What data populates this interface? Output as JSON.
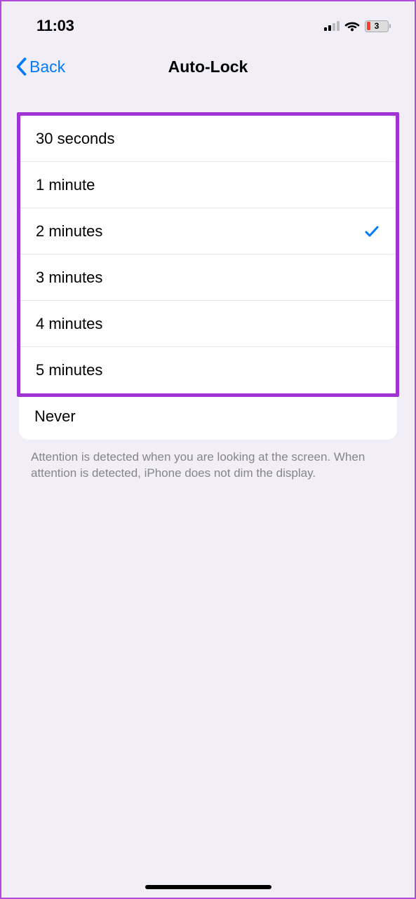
{
  "status": {
    "time": "11:03",
    "battery_percent": "3"
  },
  "nav": {
    "back_label": "Back",
    "title": "Auto-Lock"
  },
  "options": [
    {
      "label": "30 seconds",
      "selected": false
    },
    {
      "label": "1 minute",
      "selected": false
    },
    {
      "label": "2 minutes",
      "selected": true
    },
    {
      "label": "3 minutes",
      "selected": false
    },
    {
      "label": "4 minutes",
      "selected": false
    },
    {
      "label": "5 minutes",
      "selected": false
    },
    {
      "label": "Never",
      "selected": false
    }
  ],
  "footer": "Attention is detected when you are looking at the screen. When attention is detected, iPhone does not dim the display."
}
